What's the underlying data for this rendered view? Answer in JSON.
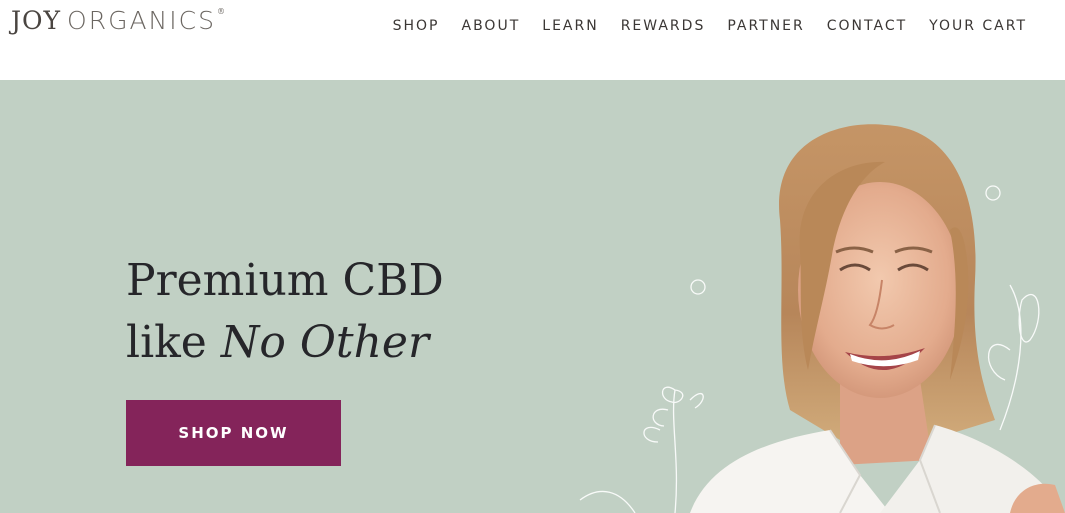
{
  "brand": {
    "name_part1": "JOY",
    "name_part2": "ORGANICS",
    "registered": "®"
  },
  "nav": {
    "items": [
      {
        "label": "SHOP"
      },
      {
        "label": "ABOUT"
      },
      {
        "label": "LEARN"
      },
      {
        "label": "REWARDS"
      },
      {
        "label": "PARTNER"
      },
      {
        "label": "CONTACT"
      },
      {
        "label": "YOUR CART"
      }
    ]
  },
  "hero": {
    "title_line1": "Premium CBD",
    "title_line2_plain": "like ",
    "title_line2_italic": "No Other",
    "cta_label": "SHOP NOW",
    "image_subject": "smiling-woman-photo",
    "decoration": "floral-line-art"
  },
  "colors": {
    "hero_bg": "#c1d0c4",
    "cta_bg": "#84245a",
    "text_dark": "#26262a",
    "nav_text": "#3b3735"
  }
}
